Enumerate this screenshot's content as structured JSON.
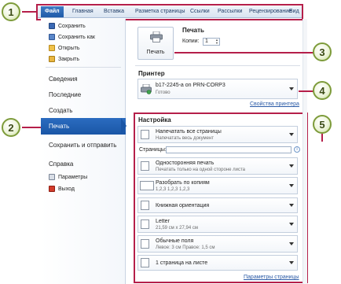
{
  "ribbon": {
    "tabs": [
      {
        "label": "Файл",
        "active": true
      },
      {
        "label": "Главная"
      },
      {
        "label": "Вставка"
      },
      {
        "label": "Разметка страницы"
      },
      {
        "label": "Ссылки"
      },
      {
        "label": "Рассылки"
      },
      {
        "label": "Рецензирование"
      },
      {
        "label": "Вид"
      }
    ]
  },
  "sidebar": {
    "quick_items": [
      {
        "label": "Сохранить",
        "icon": "save-icon"
      },
      {
        "label": "Сохранить как",
        "icon": "save-as-icon"
      },
      {
        "label": "Открыть",
        "icon": "open-folder-icon"
      },
      {
        "label": "Закрыть",
        "icon": "close-folder-icon"
      }
    ],
    "items": [
      {
        "label": "Сведения"
      },
      {
        "label": "Последние"
      },
      {
        "label": "Создать"
      },
      {
        "label": "Печать",
        "selected": true
      },
      {
        "label": "Сохранить и отправить"
      },
      {
        "label": "Справка"
      }
    ],
    "bottom_items": [
      {
        "label": "Параметры",
        "icon": "options-icon"
      },
      {
        "label": "Выход",
        "icon": "exit-icon"
      }
    ]
  },
  "print": {
    "title": "Печать",
    "button_label": "Печать",
    "copies_label": "Копии:",
    "copies_value": "1"
  },
  "printer": {
    "title": "Принтер",
    "name": "b17-2245-a on PRN-CORP3",
    "status": "Готово",
    "properties_link": "Свойства принтера"
  },
  "settings": {
    "title": "Настройка",
    "pages_label": "Страницы:",
    "pages_value": "",
    "items": [
      {
        "main": "Напечатать все страницы",
        "sub": "Напечатать весь документ"
      },
      {
        "main": "Односторонняя печать",
        "sub": "Печатать только на одной стороне листа"
      },
      {
        "main": "Разобрать по копиям",
        "sub": "1,2,3    1,2,3    1,2,3"
      },
      {
        "main": "Книжная ориентация",
        "sub": ""
      },
      {
        "main": "Letter",
        "sub": "21,59 см x 27,94 см"
      },
      {
        "main": "Обычные поля",
        "sub": "Левое:  3 см    Правое:  1,5 см"
      },
      {
        "main": "1 страница на листе",
        "sub": ""
      }
    ],
    "page_setup_link": "Параметры страницы"
  },
  "callouts": [
    "1",
    "2",
    "3",
    "4",
    "5"
  ],
  "colors": {
    "accent": "#1a56a6",
    "callout_line": "#b51f4a",
    "callout_border": "#7d9b3a"
  }
}
